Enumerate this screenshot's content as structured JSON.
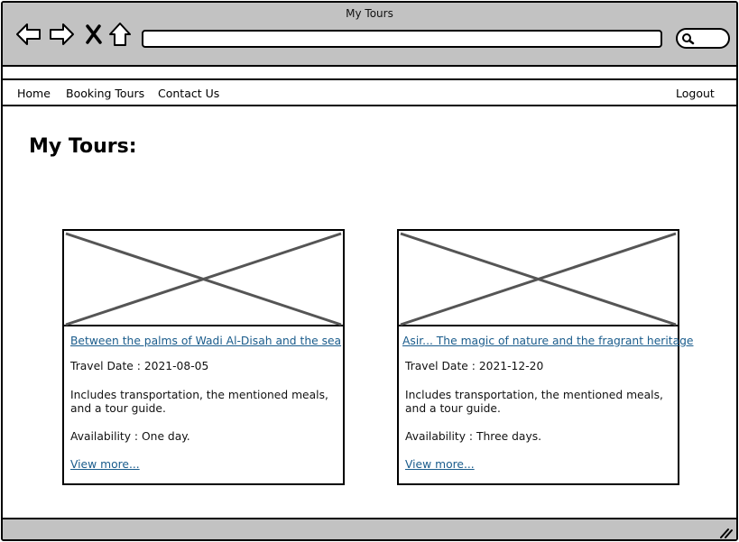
{
  "window": {
    "title": "My Tours"
  },
  "nav": {
    "items": [
      "Home",
      "Booking Tours",
      "Contact Us"
    ],
    "logout": "Logout"
  },
  "page": {
    "title": "My Tours:"
  },
  "tours": [
    {
      "title": "Between the palms of Wadi Al-Disah and the sea",
      "travel_date": "Travel Date : 2021-08-05",
      "includes": "Includes transportation, the mentioned meals, and a tour guide.",
      "availability": "Availability : One day.",
      "link": "View more..."
    },
    {
      "title": "Asir... The magic of nature and the fragrant heritage",
      "travel_date": "Travel Date : 2021-12-20",
      "includes": "Includes transportation, the mentioned meals, and a tour guide.",
      "availability": "Availability : Three days.",
      "link": "View more..."
    }
  ],
  "icons": [
    "back-arrow-icon",
    "forward-arrow-icon",
    "close-icon",
    "home-icon",
    "search-icon",
    "resize-grip-icon",
    "image-placeholder-icon"
  ],
  "colors": {
    "chrome": "#c2c2c2",
    "link": "#1a5c8c",
    "border": "#000000"
  }
}
